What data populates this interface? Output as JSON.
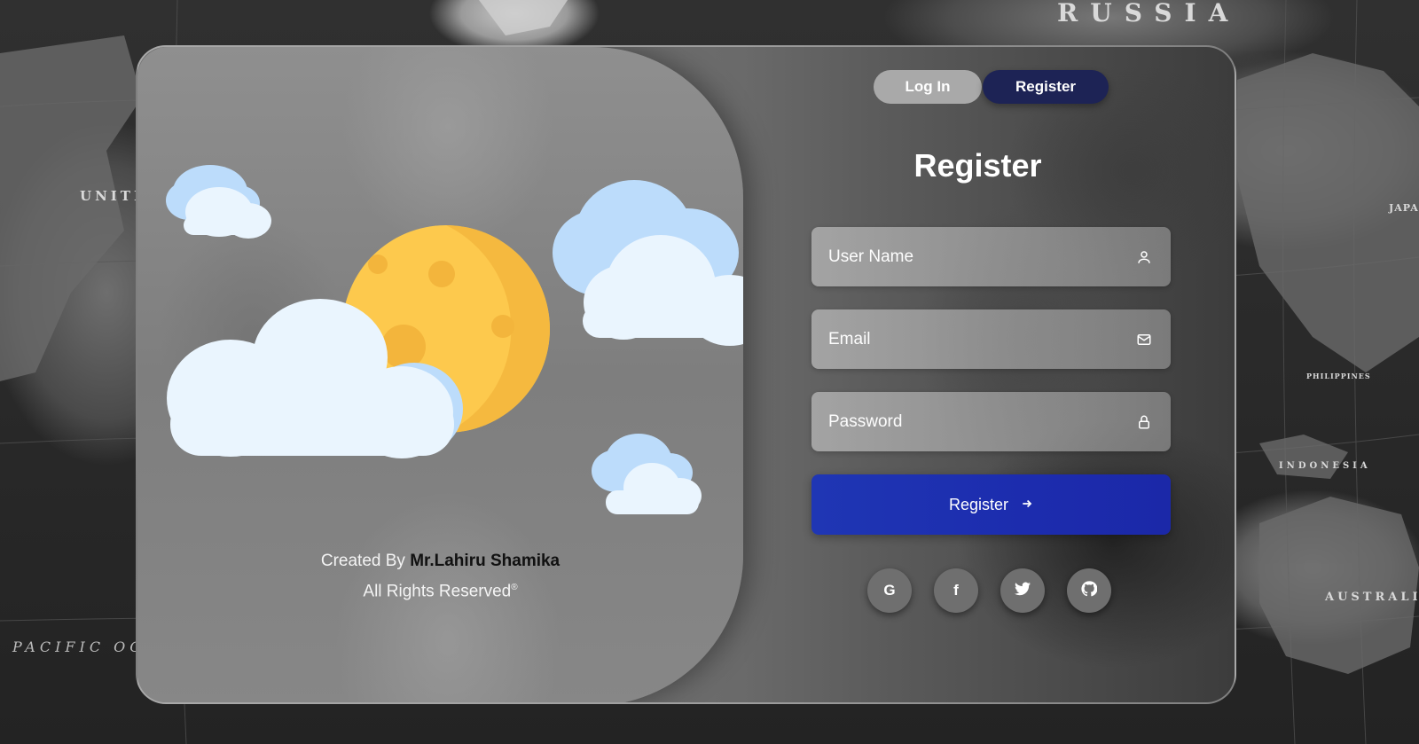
{
  "background": {
    "labels": {
      "russia": "RUSSIA",
      "unite": "UNITE",
      "pacific": "PACIFIC OC",
      "australia": "AUSTRALIA",
      "indonesia": "INDONESIA",
      "japan": "JAPAN",
      "philippines": "PHILIPPINES"
    }
  },
  "tabs": {
    "login_label": "Log In",
    "register_label": "Register",
    "active": "Register"
  },
  "form": {
    "title": "Register",
    "username": {
      "placeholder": "User Name",
      "value": "",
      "icon": "user-icon"
    },
    "email": {
      "placeholder": "Email",
      "value": "",
      "icon": "mail-icon"
    },
    "password": {
      "placeholder": "Password",
      "value": "",
      "icon": "lock-icon"
    },
    "submit_label": "Register",
    "submit_icon": "arrow-right-icon",
    "accent_color": "#1f36b4"
  },
  "socials": [
    {
      "name": "google",
      "glyph": "G"
    },
    {
      "name": "facebook",
      "glyph": "f"
    },
    {
      "name": "twitter",
      "glyph": "twitter"
    },
    {
      "name": "github",
      "glyph": "github"
    }
  ],
  "credits": {
    "prefix": "Created By",
    "author": "Mr.Lahiru Shamika",
    "rights": "All Rights Reserved",
    "rights_mark": "®"
  },
  "illustration": {
    "moon_color": "#fdc94d",
    "cloud_color": "#eaf5fe",
    "cloud_shade_color": "#bcdcfb"
  }
}
